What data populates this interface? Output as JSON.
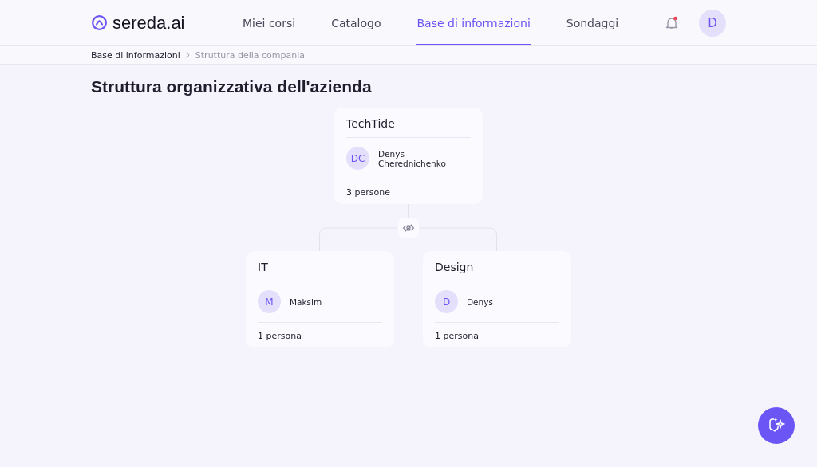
{
  "logo": {
    "text": "sereda.ai"
  },
  "nav": [
    {
      "label": "Miei corsi",
      "selected": false
    },
    {
      "label": "Catalogo",
      "selected": false
    },
    {
      "label": "Base di informazioni",
      "selected": true
    },
    {
      "label": "Sondaggi",
      "selected": false
    }
  ],
  "notifications": {
    "unread": true
  },
  "user": {
    "initials": "D"
  },
  "breadcrumb": [
    "Base di informazioni",
    "Struttura della compania"
  ],
  "title": "Struttura organizzativa dell'azienda",
  "org": {
    "name": "TechTide",
    "head": {
      "initials": "DC",
      "name": "Denys Cherednichenko"
    },
    "count": "3 persone",
    "children": [
      {
        "name": "IT",
        "head": {
          "initials": "M",
          "name": "Maksim"
        },
        "count": "1 persona"
      },
      {
        "name": "Design",
        "head": {
          "initials": "D",
          "name": "Denys"
        },
        "count": "1 persona"
      }
    ]
  }
}
